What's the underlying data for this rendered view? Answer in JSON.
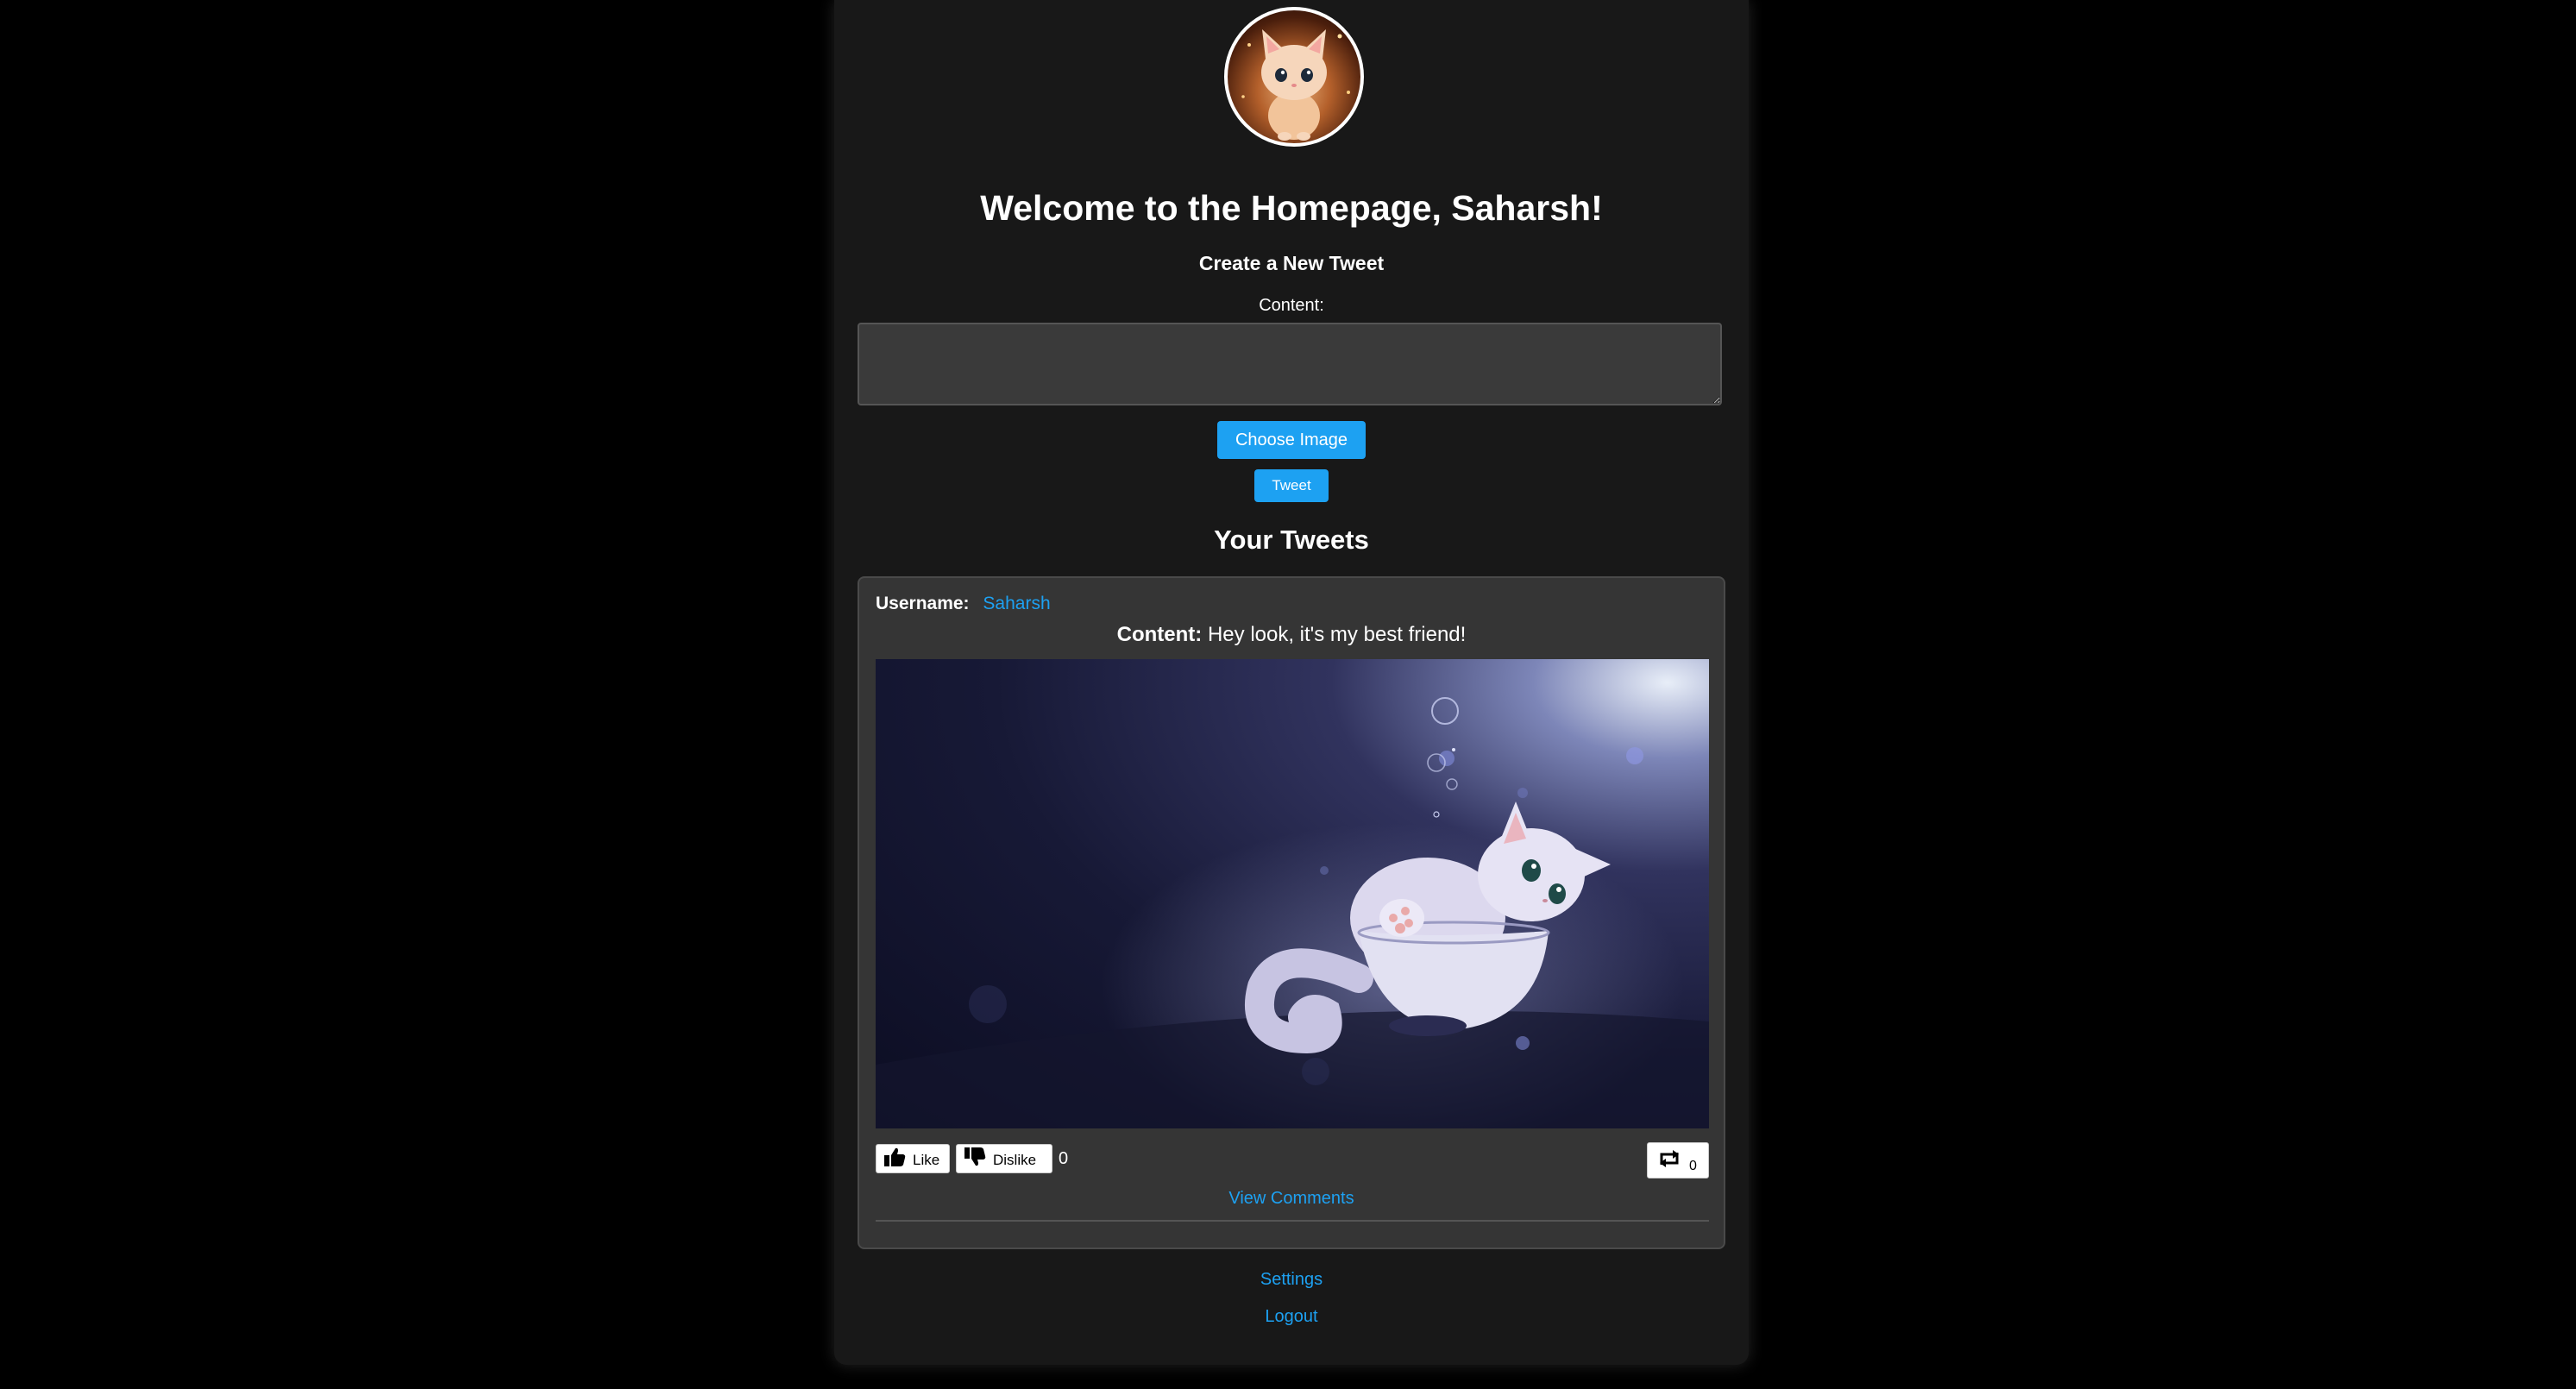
{
  "header": {
    "welcome_title": "Welcome to the Homepage, Saharsh!",
    "avatar_icon": "cat-avatar-icon"
  },
  "compose": {
    "title": "Create a New Tweet",
    "content_label": "Content:",
    "content_value": "",
    "choose_image_label": "Choose Image",
    "tweet_button_label": "Tweet"
  },
  "tweets_section": {
    "title": "Your Tweets"
  },
  "tweets": [
    {
      "username_label": "Username:",
      "username": "Saharsh",
      "content_label": "Content:",
      "content": "Hey look, it's my best friend!",
      "image_icon": "cat-in-bowl-image",
      "like_label": "Like",
      "dislike_label": "Dislike",
      "like_dislike_count": "0",
      "retweet_count": "0",
      "view_comments_label": "View Comments"
    }
  ],
  "footer": {
    "settings_label": "Settings",
    "logout_label": "Logout"
  },
  "colors": {
    "accent": "#1da1f2",
    "page_bg": "#000000",
    "panel_bg": "#181818",
    "card_bg": "#353535"
  }
}
